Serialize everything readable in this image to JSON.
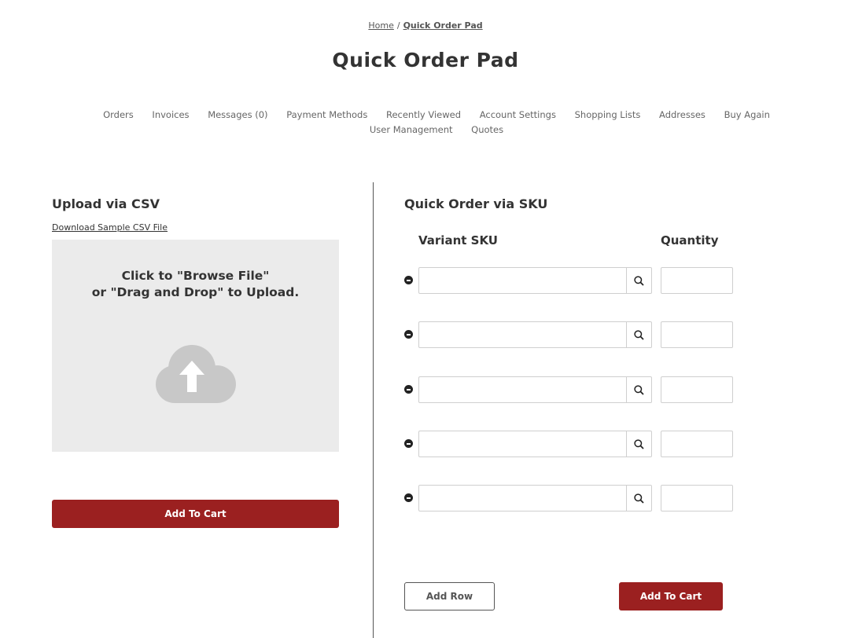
{
  "breadcrumb": {
    "home": "Home",
    "separator": "/",
    "current": "Quick Order Pad"
  },
  "page_title": "Quick Order Pad",
  "account_nav": [
    "Orders",
    "Invoices",
    "Messages (0)",
    "Payment Methods",
    "Recently Viewed",
    "Account Settings",
    "Shopping Lists",
    "Addresses",
    "Buy Again",
    "User Management",
    "Quotes"
  ],
  "csv_upload": {
    "title": "Upload via CSV",
    "download_link": "Download Sample CSV File",
    "dropzone_line1": "Click to \"Browse File\"",
    "dropzone_line2": "or \"Drag and Drop\" to Upload.",
    "dropzone_icon": "cloud-upload-icon",
    "add_to_cart": "Add To Cart"
  },
  "quick_order": {
    "title": "Quick Order via SKU",
    "sku_header": "Variant SKU",
    "qty_header": "Quantity",
    "rows": [
      {
        "sku": "",
        "qty": ""
      },
      {
        "sku": "",
        "qty": ""
      },
      {
        "sku": "",
        "qty": ""
      },
      {
        "sku": "",
        "qty": ""
      },
      {
        "sku": "",
        "qty": ""
      }
    ],
    "add_row": "Add Row",
    "add_to_cart": "Add To Cart"
  },
  "colors": {
    "primary_button": "#9b2020",
    "dropzone_bg": "#ebebeb",
    "cloud_icon": "#c8c8c8"
  }
}
